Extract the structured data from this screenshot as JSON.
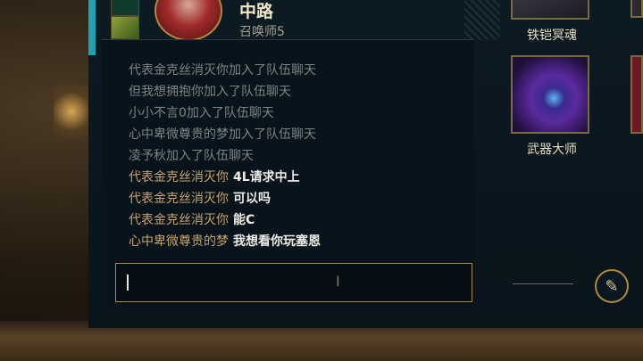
{
  "header": {
    "position": "中路",
    "summoner": "召唤师5"
  },
  "chat": {
    "lines": [
      {
        "type": "system",
        "text": "代表金克丝消灭你加入了队伍聊天"
      },
      {
        "type": "system",
        "text": "但我想拥抱你加入了队伍聊天"
      },
      {
        "type": "system",
        "text": "小小不言0加入了队伍聊天"
      },
      {
        "type": "system",
        "text": "心中卑微尊贵的梦加入了队伍聊天"
      },
      {
        "type": "system",
        "text": "凌予秋加入了队伍聊天"
      },
      {
        "type": "message",
        "player": "代表金克丝消灭你",
        "text": "4L请求中上"
      },
      {
        "type": "message",
        "player": "代表金克丝消灭你",
        "text": "可以吗"
      },
      {
        "type": "message",
        "player": "代表金克丝消灭你",
        "text": "能C"
      },
      {
        "type": "message",
        "player": "心中卑微尊贵的梦",
        "text": "我想看你玩塞恩"
      }
    ],
    "input_value": ""
  },
  "champions": [
    {
      "name": "铁铠冥魂"
    },
    {
      "name": "武器大师"
    }
  ],
  "icons": {
    "edit": "pencil-icon"
  },
  "colors": {
    "accent_gold": "#b08a3e",
    "player_name": "#c8a36a",
    "system_text": "#7c8584",
    "teal_bar": "#1fa3b3"
  }
}
